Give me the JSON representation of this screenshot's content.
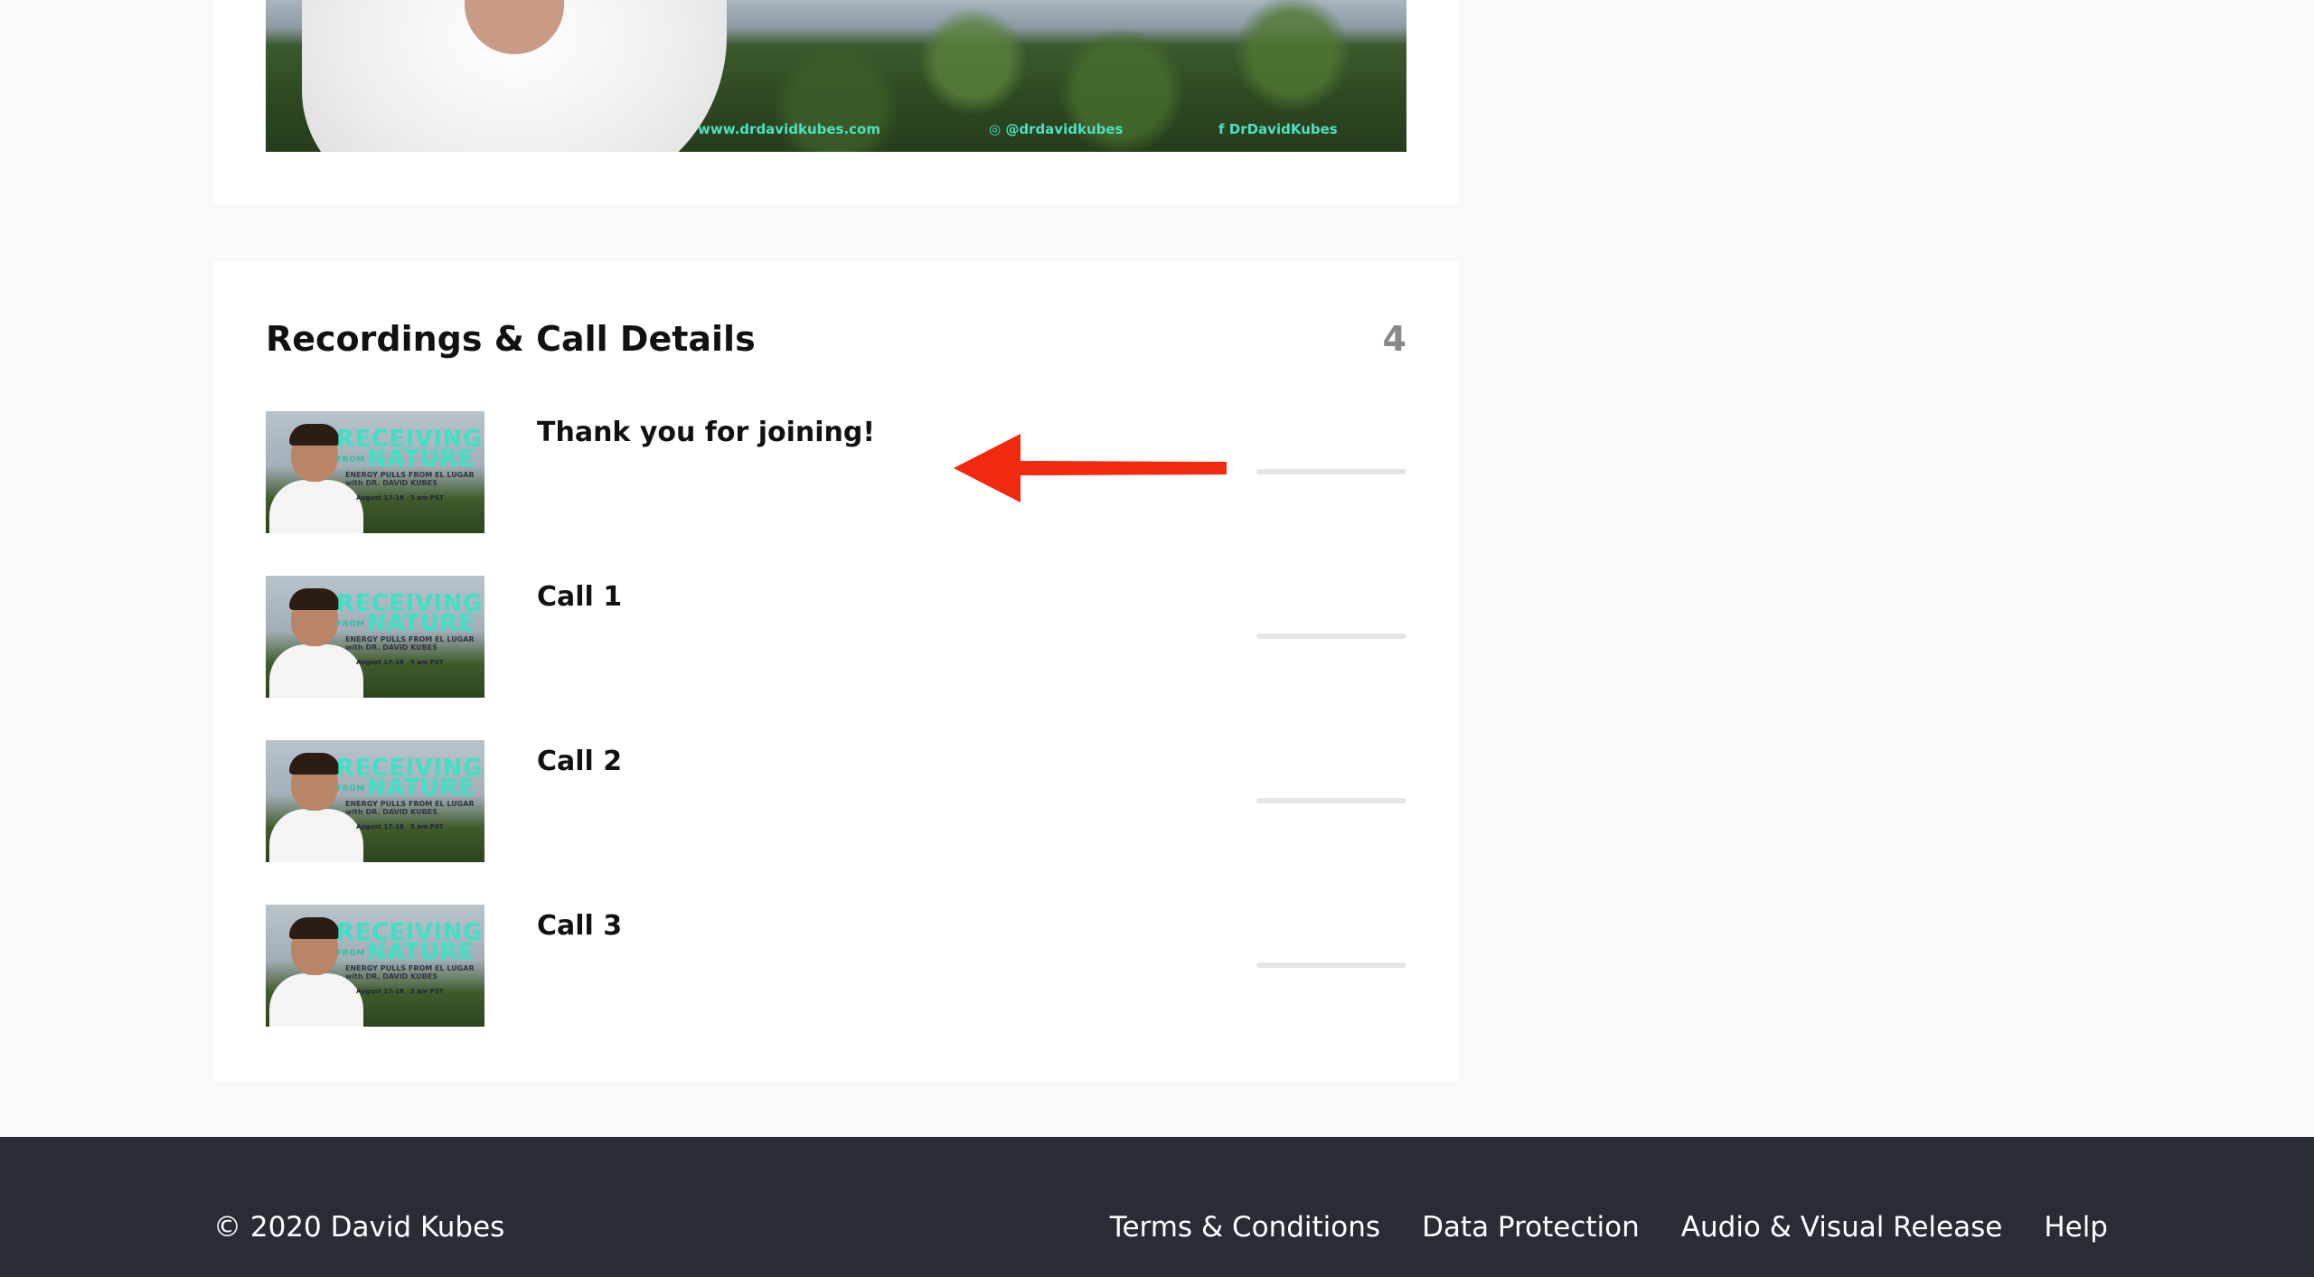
{
  "hero": {
    "links": [
      "www.drdavidkubes.com",
      "@drdavidkubes",
      "DrDavidKubes"
    ]
  },
  "recordings": {
    "title": "Recordings & Call Details",
    "count": "4",
    "thumbnail": {
      "title_line1": "RECEIVING",
      "title_from": "FROM",
      "title_line2": "NATURE",
      "subtitle": "ENERGY PULLS FROM EL LUGAR",
      "host": "with DR. DAVID KUBES",
      "date": "August 17-18",
      "time": "5 am PST"
    },
    "items": [
      {
        "label": "Thank you for joining!",
        "progress": 0
      },
      {
        "label": "Call 1",
        "progress": 0
      },
      {
        "label": "Call 2",
        "progress": 0
      },
      {
        "label": "Call 3",
        "progress": 0
      }
    ]
  },
  "annotation": {
    "color": "#f2280f"
  },
  "footer": {
    "copyright": "© 2020 David Kubes",
    "links": [
      "Terms & Conditions",
      "Data Protection",
      "Audio & Visual Release",
      "Help"
    ]
  }
}
